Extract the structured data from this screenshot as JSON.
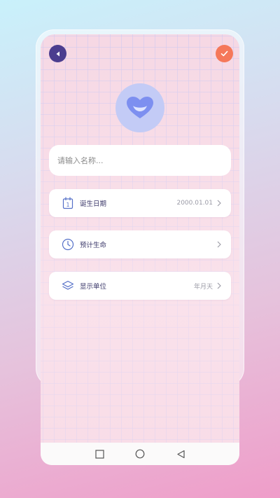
{
  "name_input": {
    "placeholder": "请输入名称...",
    "value": ""
  },
  "settings": [
    {
      "label": "诞生日期",
      "value": "2000.01.01",
      "icon": "calendar-icon"
    },
    {
      "label": "预计生命",
      "value": "",
      "icon": "clock-icon"
    },
    {
      "label": "显示单位",
      "value": "年月天",
      "icon": "layers-icon"
    }
  ],
  "calendar_day": "1",
  "colors": {
    "back_button": "#4b3d8f",
    "confirm_button": "#f5785a",
    "avatar_bg": "#c3cbf6",
    "heart": "#7d8ff0",
    "label_text": "#3d3a6b"
  },
  "icons": {
    "back": "caret-left-icon",
    "confirm": "check-icon",
    "avatar": "heart-icon",
    "nav_recent": "square-icon",
    "nav_home": "circle-icon",
    "nav_back": "triangle-back-icon"
  }
}
